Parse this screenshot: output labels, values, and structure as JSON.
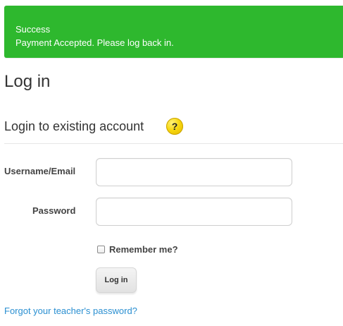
{
  "alert": {
    "title": "Success",
    "message": "Payment Accepted. Please log back in.",
    "color": "#2eb82e"
  },
  "page": {
    "title": "Log in"
  },
  "login_section": {
    "title": "Login to existing account",
    "help_icon": "question-mark-icon",
    "help_icon_glyph": "?",
    "username_label": "Username/Email",
    "username_value": "",
    "password_label": "Password",
    "password_value": "",
    "remember_label": "Remember me?",
    "remember_checked": false,
    "submit_label": "Log in",
    "forgot_link": "Forgot your teacher's password?"
  },
  "colors": {
    "link": "#2a8fd1",
    "help_icon": "#f7d70e"
  }
}
